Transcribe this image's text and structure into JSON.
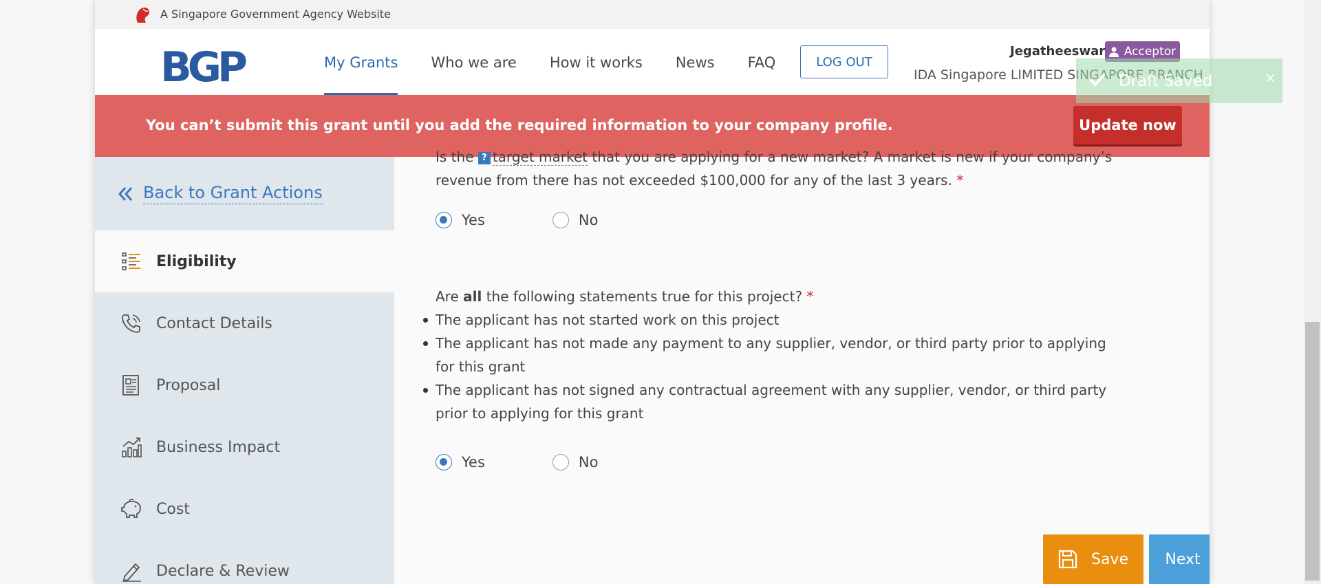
{
  "gov_strip": {
    "text": "A Singapore Government Agency Website"
  },
  "header": {
    "logo": "BGP",
    "nav": [
      "My Grants",
      "Who we are",
      "How it works",
      "News",
      "FAQ"
    ],
    "logout_label": "LOG OUT",
    "user_name": "Jegatheeswari",
    "role": "Acceptor",
    "company": "IDA Singapore LIMITED SINGAPORE BRANCH"
  },
  "alert": {
    "message": "You can’t submit this grant until you add the required information to your company profile.",
    "button": "Update now",
    "color": "#de6361"
  },
  "sidebar": {
    "back_label": "Back to Grant Actions",
    "items": [
      {
        "label": "Eligibility",
        "icon": "list-icon",
        "active": true
      },
      {
        "label": "Contact Details",
        "icon": "phone-icon"
      },
      {
        "label": "Proposal",
        "icon": "document-icon"
      },
      {
        "label": "Business Impact",
        "icon": "chart-icon"
      },
      {
        "label": "Cost",
        "icon": "piggy-bank-icon"
      },
      {
        "label": "Declare & Review",
        "icon": "pen-icon"
      }
    ]
  },
  "main": {
    "q1_prefix": "Is the",
    "q1_term": "target market",
    "q1_rest": "that you are applying for a new market? A market is new if your company’s",
    "q1_line2": "revenue from there has not exceeded $100,000 for any of the last 3 years.",
    "q1_selected": "Yes",
    "q2_pre": "Are",
    "q2_bold": "all",
    "q2_post": "the following statements true for this project?",
    "bullets": [
      "The applicant has not started work on this project",
      "The applicant has not made any payment to any supplier, vendor, or third party prior to applying for this grant",
      "The applicant has not signed any contractual agreement with any supplier, vendor, or third party prior to applying for this grant"
    ],
    "q2_selected": "Yes",
    "yes_label": "Yes",
    "no_label": "No",
    "required_mark": "*",
    "save_label": "Save",
    "next_label": "Next"
  },
  "toast": {
    "text": "Draft Saved",
    "close": "×"
  }
}
